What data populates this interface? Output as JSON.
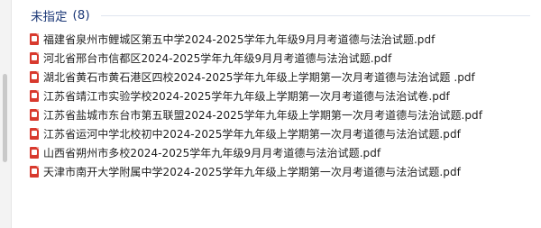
{
  "group": {
    "title": "未指定",
    "count": "(8)"
  },
  "files": [
    {
      "name": "福建省泉州市鲤城区第五中学2024-2025学年九年级9月月考道德与法治试题.pdf",
      "icon": "pdf-icon"
    },
    {
      "name": "河北省邢台市信都区2024-2025学年九年级9月月考道德与法治试题.pdf",
      "icon": "pdf-icon"
    },
    {
      "name": "湖北省黄石市黄石港区四校2024-2025学年九年级上学期第一次月考道德与法治试题 .pdf",
      "icon": "pdf-icon"
    },
    {
      "name": "江苏省靖江市实验学校2024-2025学年九年级上学期第一次月考道德与法治试卷.pdf",
      "icon": "pdf-icon"
    },
    {
      "name": "江苏省盐城市东台市第五联盟2024-2025学年九年级上学期第一次月考道德与法治试题.pdf",
      "icon": "pdf-icon"
    },
    {
      "name": "江苏省运河中学北校初中2024-2025学年九年级上学期第一次月考道德与法治试题.pdf",
      "icon": "pdf-icon"
    },
    {
      "name": "山西省朔州市多校2024-2025学年九年级9月月考道德与法治试题.pdf",
      "icon": "pdf-icon"
    },
    {
      "name": "天津市南开大学附属中学2024-2025学年九年级上学期第一次月考道德与法治试题.pdf",
      "icon": "pdf-icon"
    }
  ],
  "colors": {
    "group_header": "#1e3a78",
    "pdf_icon": "#d83a2e",
    "file_text": "#1f1f1f"
  }
}
